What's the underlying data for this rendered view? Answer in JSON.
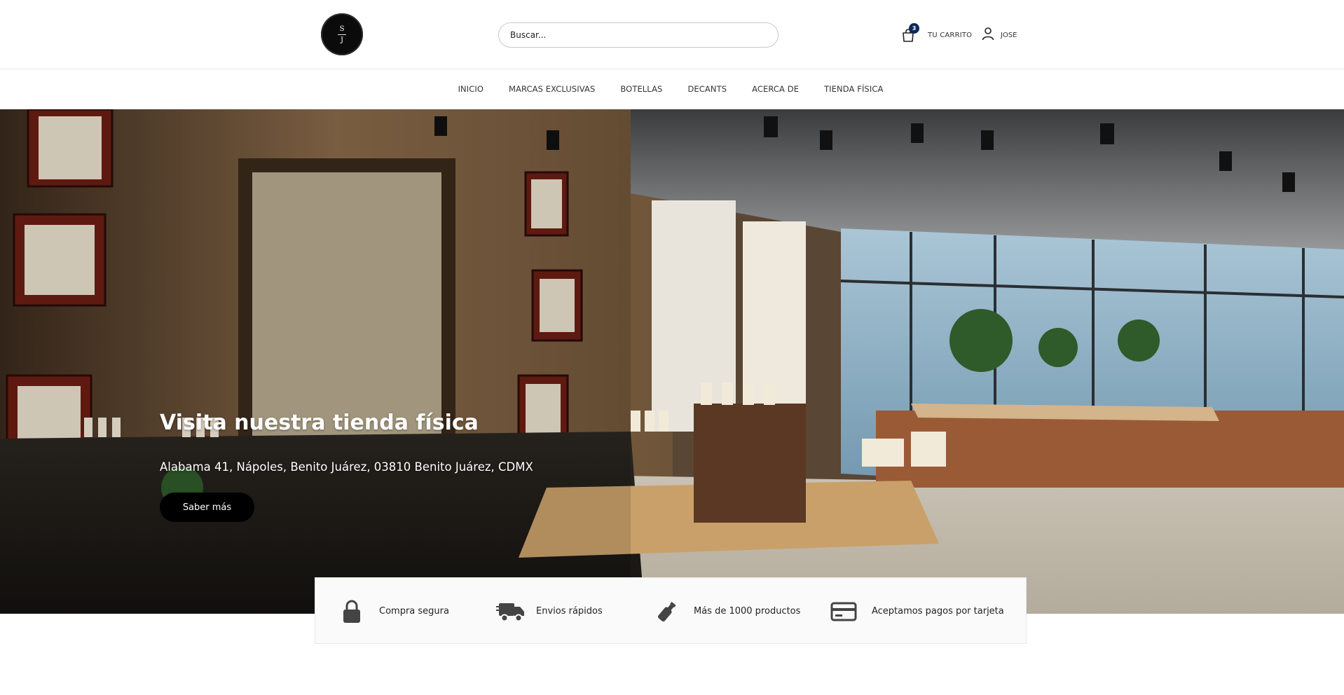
{
  "header": {
    "logo": {
      "top": "S",
      "bottom": "J"
    },
    "search": {
      "placeholder": "Buscar...",
      "value": ""
    },
    "cart": {
      "count": "3",
      "label": "TU CARRITO"
    },
    "user": {
      "label": "JOSE"
    }
  },
  "nav": {
    "items": [
      {
        "label": "INICIO"
      },
      {
        "label": "MARCAS EXCLUSIVAS"
      },
      {
        "label": "BOTELLAS"
      },
      {
        "label": "DECANTS"
      },
      {
        "label": "ACERCA DE"
      },
      {
        "label": "TIENDA FÍSICA"
      }
    ]
  },
  "hero": {
    "title": "Visita nuestra tienda física",
    "address": "Alabama 41, Nápoles, Benito Juárez, 03810 Benito Juárez, CDMX",
    "button_label": "Saber más"
  },
  "features": [
    {
      "icon": "lock-icon",
      "text": "Compra segura"
    },
    {
      "icon": "truck-icon",
      "text": "Envios rápidos"
    },
    {
      "icon": "perfume-bottle-icon",
      "text": "Más de 1000 productos"
    },
    {
      "icon": "credit-card-icon",
      "text": "Aceptamos pagos por tarjeta"
    }
  ],
  "colors": {
    "brand_dark": "#000000",
    "badge": "#0b2a5a",
    "nav_text": "#333333"
  }
}
